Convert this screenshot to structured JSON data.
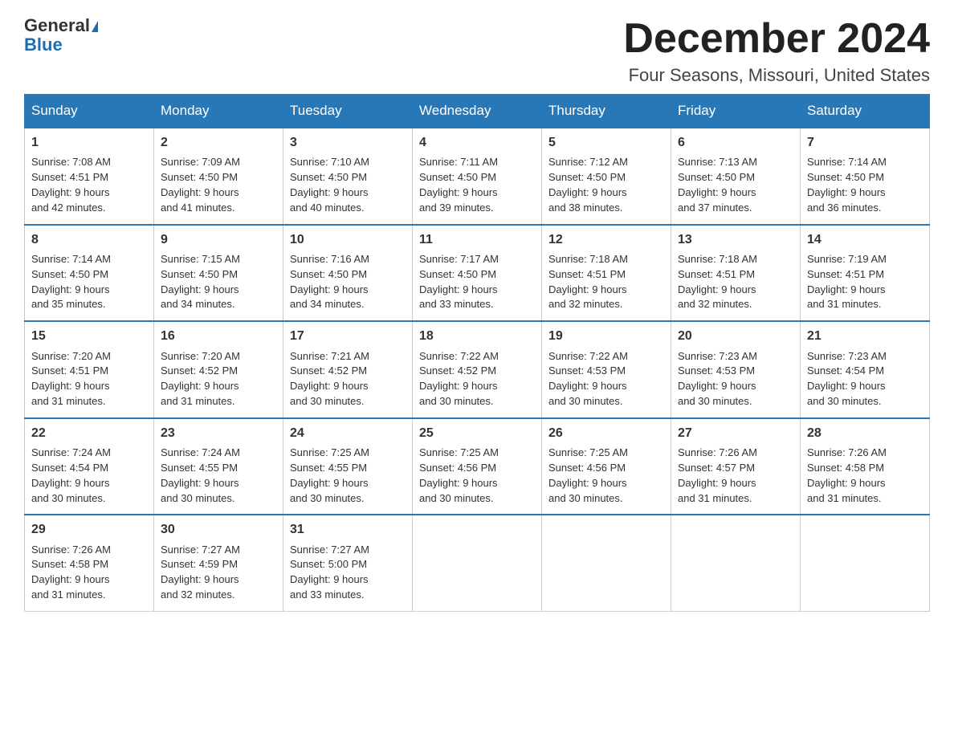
{
  "logo": {
    "line1": "General",
    "line2": "Blue"
  },
  "title": "December 2024",
  "subtitle": "Four Seasons, Missouri, United States",
  "weekdays": [
    "Sunday",
    "Monday",
    "Tuesday",
    "Wednesday",
    "Thursday",
    "Friday",
    "Saturday"
  ],
  "weeks": [
    [
      {
        "num": "1",
        "sunrise": "7:08 AM",
        "sunset": "4:51 PM",
        "daylight": "9 hours and 42 minutes."
      },
      {
        "num": "2",
        "sunrise": "7:09 AM",
        "sunset": "4:50 PM",
        "daylight": "9 hours and 41 minutes."
      },
      {
        "num": "3",
        "sunrise": "7:10 AM",
        "sunset": "4:50 PM",
        "daylight": "9 hours and 40 minutes."
      },
      {
        "num": "4",
        "sunrise": "7:11 AM",
        "sunset": "4:50 PM",
        "daylight": "9 hours and 39 minutes."
      },
      {
        "num": "5",
        "sunrise": "7:12 AM",
        "sunset": "4:50 PM",
        "daylight": "9 hours and 38 minutes."
      },
      {
        "num": "6",
        "sunrise": "7:13 AM",
        "sunset": "4:50 PM",
        "daylight": "9 hours and 37 minutes."
      },
      {
        "num": "7",
        "sunrise": "7:14 AM",
        "sunset": "4:50 PM",
        "daylight": "9 hours and 36 minutes."
      }
    ],
    [
      {
        "num": "8",
        "sunrise": "7:14 AM",
        "sunset": "4:50 PM",
        "daylight": "9 hours and 35 minutes."
      },
      {
        "num": "9",
        "sunrise": "7:15 AM",
        "sunset": "4:50 PM",
        "daylight": "9 hours and 34 minutes."
      },
      {
        "num": "10",
        "sunrise": "7:16 AM",
        "sunset": "4:50 PM",
        "daylight": "9 hours and 34 minutes."
      },
      {
        "num": "11",
        "sunrise": "7:17 AM",
        "sunset": "4:50 PM",
        "daylight": "9 hours and 33 minutes."
      },
      {
        "num": "12",
        "sunrise": "7:18 AM",
        "sunset": "4:51 PM",
        "daylight": "9 hours and 32 minutes."
      },
      {
        "num": "13",
        "sunrise": "7:18 AM",
        "sunset": "4:51 PM",
        "daylight": "9 hours and 32 minutes."
      },
      {
        "num": "14",
        "sunrise": "7:19 AM",
        "sunset": "4:51 PM",
        "daylight": "9 hours and 31 minutes."
      }
    ],
    [
      {
        "num": "15",
        "sunrise": "7:20 AM",
        "sunset": "4:51 PM",
        "daylight": "9 hours and 31 minutes."
      },
      {
        "num": "16",
        "sunrise": "7:20 AM",
        "sunset": "4:52 PM",
        "daylight": "9 hours and 31 minutes."
      },
      {
        "num": "17",
        "sunrise": "7:21 AM",
        "sunset": "4:52 PM",
        "daylight": "9 hours and 30 minutes."
      },
      {
        "num": "18",
        "sunrise": "7:22 AM",
        "sunset": "4:52 PM",
        "daylight": "9 hours and 30 minutes."
      },
      {
        "num": "19",
        "sunrise": "7:22 AM",
        "sunset": "4:53 PM",
        "daylight": "9 hours and 30 minutes."
      },
      {
        "num": "20",
        "sunrise": "7:23 AM",
        "sunset": "4:53 PM",
        "daylight": "9 hours and 30 minutes."
      },
      {
        "num": "21",
        "sunrise": "7:23 AM",
        "sunset": "4:54 PM",
        "daylight": "9 hours and 30 minutes."
      }
    ],
    [
      {
        "num": "22",
        "sunrise": "7:24 AM",
        "sunset": "4:54 PM",
        "daylight": "9 hours and 30 minutes."
      },
      {
        "num": "23",
        "sunrise": "7:24 AM",
        "sunset": "4:55 PM",
        "daylight": "9 hours and 30 minutes."
      },
      {
        "num": "24",
        "sunrise": "7:25 AM",
        "sunset": "4:55 PM",
        "daylight": "9 hours and 30 minutes."
      },
      {
        "num": "25",
        "sunrise": "7:25 AM",
        "sunset": "4:56 PM",
        "daylight": "9 hours and 30 minutes."
      },
      {
        "num": "26",
        "sunrise": "7:25 AM",
        "sunset": "4:56 PM",
        "daylight": "9 hours and 30 minutes."
      },
      {
        "num": "27",
        "sunrise": "7:26 AM",
        "sunset": "4:57 PM",
        "daylight": "9 hours and 31 minutes."
      },
      {
        "num": "28",
        "sunrise": "7:26 AM",
        "sunset": "4:58 PM",
        "daylight": "9 hours and 31 minutes."
      }
    ],
    [
      {
        "num": "29",
        "sunrise": "7:26 AM",
        "sunset": "4:58 PM",
        "daylight": "9 hours and 31 minutes."
      },
      {
        "num": "30",
        "sunrise": "7:27 AM",
        "sunset": "4:59 PM",
        "daylight": "9 hours and 32 minutes."
      },
      {
        "num": "31",
        "sunrise": "7:27 AM",
        "sunset": "5:00 PM",
        "daylight": "9 hours and 33 minutes."
      },
      null,
      null,
      null,
      null
    ]
  ],
  "labels": {
    "sunrise": "Sunrise:",
    "sunset": "Sunset:",
    "daylight": "Daylight:"
  }
}
